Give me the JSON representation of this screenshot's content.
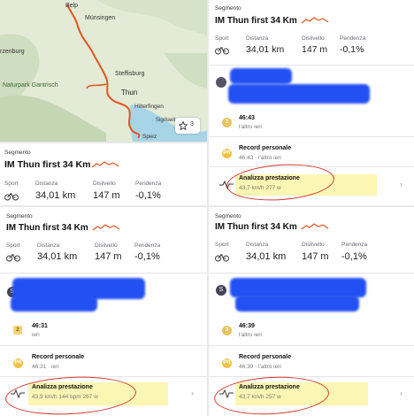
{
  "map": {
    "towns": [
      "Belp",
      "Münsingen",
      "rzenburg",
      "Steffisburg",
      "Thun",
      "Hilterfingen",
      "Sigriswil",
      "Naturpark Gantrisch",
      "Spiez"
    ],
    "photo_count": "3",
    "colors": {
      "route": "#e5561f",
      "lake": "#a8d4e8",
      "land": "#dfe8d2"
    }
  },
  "segments": [
    {
      "label": "Segmento",
      "title": "IM Thun first 34 Km",
      "stats": [
        {
          "head": "Sport"
        },
        {
          "head": "Distanza",
          "value": "34,01 km"
        },
        {
          "head": "Dislivello",
          "value": "147 m"
        },
        {
          "head": "Pendenza",
          "value": "-0,1%"
        }
      ]
    },
    {
      "label": "Segmento",
      "title": "IM Thun first 34 Km",
      "stats": [
        {
          "head": "Sport"
        },
        {
          "head": "Distanza",
          "value": "34,01 km"
        },
        {
          "head": "Dislivello",
          "value": "147 m"
        },
        {
          "head": "Pendenza",
          "value": "-0,1%"
        }
      ]
    },
    {
      "label": "Segmento",
      "title": "IM Thun first 34 Km",
      "stats": [
        {
          "head": "Sport"
        },
        {
          "head": "Distanza",
          "value": "34,01 km"
        },
        {
          "head": "Dislivello",
          "value": "147 m"
        },
        {
          "head": "Pendenza",
          "value": "-0,1%"
        }
      ]
    },
    {
      "label": "Segmento",
      "title": "IM Thun first 34 Km",
      "stats": [
        {
          "head": "Sport"
        },
        {
          "head": "Distanza",
          "value": "34,01 km"
        },
        {
          "head": "Dislivello",
          "value": "147 m"
        },
        {
          "head": "Pendenza",
          "value": "-0,1%"
        }
      ]
    }
  ],
  "efforts": {
    "top_right": {
      "rank": "2",
      "time": "46:43",
      "when": "l'altro ieri",
      "pr_title": "Record personale",
      "pr_sub": "46:43 · l'altro ieri",
      "analysis_title": "Analizza prestazione",
      "analysis_sub": "43,7 km/h 277 w"
    },
    "bottom_left": {
      "user_initial": "S",
      "rank": "2",
      "time": "46:31",
      "when": "ieri",
      "pr_title": "Record personale",
      "pr_sub": "46:31 · ieri",
      "analysis_title": "Analizza prestazione",
      "analysis_sub": "43,9 km/h 144 bpm 267 w"
    },
    "bottom_right": {
      "user_initial": "S",
      "rank": "3",
      "time": "46:39",
      "when": "l'altro ieri",
      "pr_title": "Record personale",
      "pr_sub": "46:39 · l'altro ieri",
      "analysis_title": "Analizza prestazione",
      "analysis_sub": "43,7 km/h 257 w"
    }
  },
  "icons": {
    "bike": "bike-icon",
    "chevron": "chevron-right-icon",
    "star": "star-icon",
    "pulse": "pulse-icon"
  }
}
